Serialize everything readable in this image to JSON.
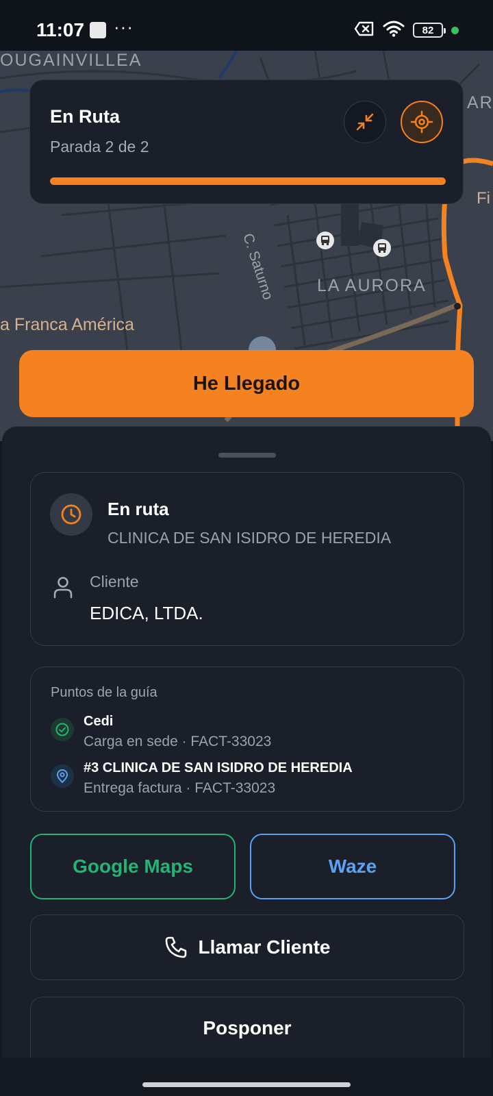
{
  "status_bar": {
    "time": "11:07",
    "dots": "···",
    "battery": "82",
    "icons": [
      "notification-icon",
      "no-sim-icon",
      "wifi-icon",
      "battery-icon",
      "privacy-dot"
    ]
  },
  "map": {
    "labels": {
      "bougainvillea": "OUGAINVILLEA",
      "ar": "AR",
      "fi": "Fi",
      "saturno": "C. Saturno",
      "aurora": "LA AURORA",
      "franca": "a Franca América"
    }
  },
  "route_card": {
    "title": "En Ruta",
    "subtitle": "Parada 2 de 2",
    "progress_fraction": 1.0
  },
  "arrived_button": {
    "label": "He Llegado"
  },
  "info_card": {
    "status": "En ruta",
    "place": "CLINICA DE SAN ISIDRO DE HEREDIA",
    "client_label": "Cliente",
    "client_name": "EDICA, LTDA."
  },
  "points_card": {
    "title": "Puntos de la guía",
    "items": [
      {
        "name": "Cedi",
        "detail": "Carga en sede · FACT-33023",
        "icon": "check-circle-icon"
      },
      {
        "name": "#3 CLINICA DE SAN ISIDRO DE HEREDIA",
        "detail": "Entrega factura · FACT-33023",
        "icon": "map-pin-icon"
      }
    ]
  },
  "buttons": {
    "google_maps": "Google Maps",
    "waze": "Waze",
    "call_client": "Llamar Cliente",
    "postpone": "Posponer"
  },
  "colors": {
    "accent": "#f58220",
    "google_maps": "#22b573",
    "waze": "#5ba3f2",
    "background": "#1a1f29"
  }
}
